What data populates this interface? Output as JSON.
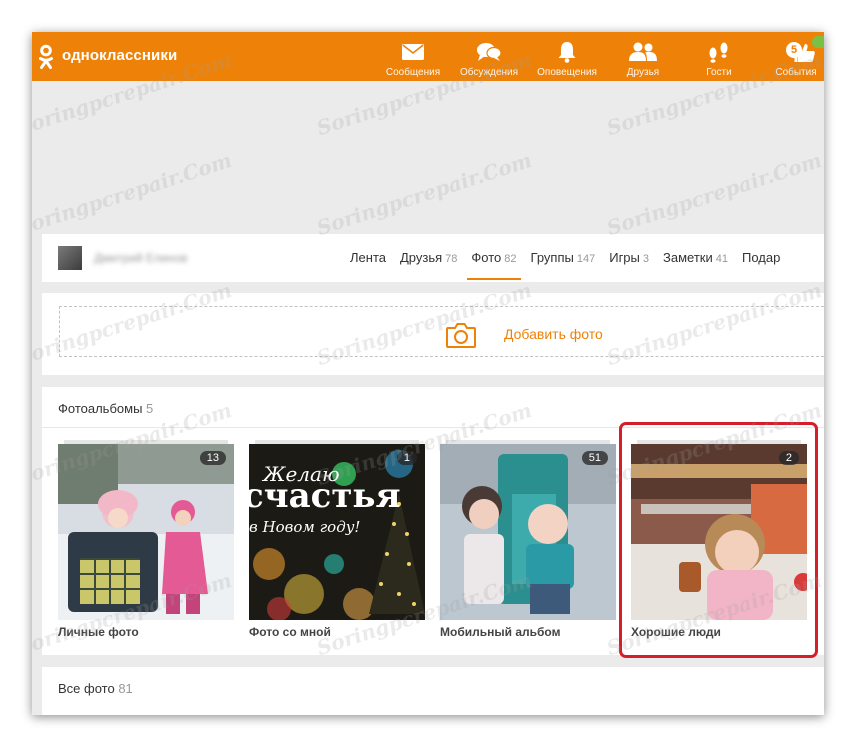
{
  "header": {
    "brand": "одноклассники",
    "nav": [
      {
        "label": "Сообщения",
        "icon": "envelope-icon"
      },
      {
        "label": "Обсуждения",
        "icon": "chat-bubbles-icon"
      },
      {
        "label": "Оповещения",
        "icon": "bell-icon"
      },
      {
        "label": "Друзья",
        "icon": "friends-icon"
      },
      {
        "label": "Гости",
        "icon": "footprints-icon"
      },
      {
        "label": "События",
        "icon": "thumbs-up-icon",
        "badge": "5"
      }
    ]
  },
  "profile": {
    "name": "Дмитрий Елинов",
    "tabs": [
      {
        "label": "Лента",
        "count": ""
      },
      {
        "label": "Друзья",
        "count": "78"
      },
      {
        "label": "Фото",
        "count": "82",
        "active": true
      },
      {
        "label": "Группы",
        "count": "147"
      },
      {
        "label": "Игры",
        "count": "3"
      },
      {
        "label": "Заметки",
        "count": "41"
      },
      {
        "label": "Подар",
        "count": ""
      }
    ]
  },
  "add_photo": {
    "label": "Добавить фото",
    "icon": "camera-icon"
  },
  "albums_section": {
    "title": "Фотоальбомы",
    "count": "5",
    "albums": [
      {
        "name": "Личные фото",
        "count": "13"
      },
      {
        "name": "Фото со мной",
        "count": "1",
        "image_text_line1": "Желаю",
        "image_text_line2": "счастья",
        "image_text_line3": "в Новом году!"
      },
      {
        "name": "Мобильный альбом",
        "count": "51"
      },
      {
        "name": "Хорошие люди",
        "count": "2",
        "highlighted": true
      }
    ]
  },
  "all_photos": {
    "title": "Все фото",
    "count": "81"
  },
  "watermark": "Soringpcrepair.Com",
  "colors": {
    "accent": "#ee8208",
    "highlight": "#d41e2a",
    "background": "#ebebeb"
  }
}
